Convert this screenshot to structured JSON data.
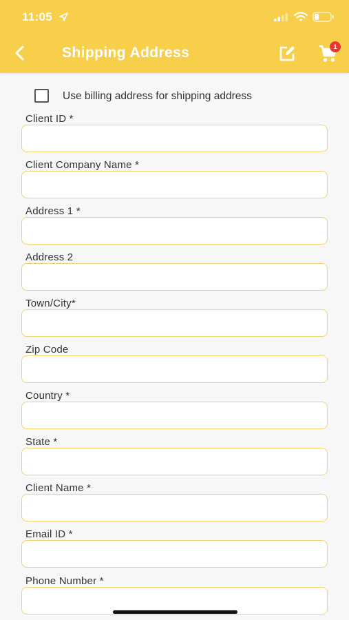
{
  "status_bar": {
    "time": "11:05",
    "icons": [
      "location-arrow-icon",
      "signal-icon",
      "wifi-icon",
      "battery-icon"
    ]
  },
  "nav": {
    "title": "Shipping Address",
    "back_icon": "chevron-left-icon",
    "edit_icon": "edit-icon",
    "cart_icon": "cart-icon",
    "cart_count": "1"
  },
  "billing_checkbox": {
    "label": "Use billing address for shipping address",
    "checked": false
  },
  "fields": [
    {
      "label": "Client ID *",
      "value": "",
      "placeholder": ""
    },
    {
      "label": "Client Company Name *",
      "value": "",
      "placeholder": ""
    },
    {
      "label": "Address 1 *",
      "value": "",
      "placeholder": ""
    },
    {
      "label": "Address 2",
      "value": "",
      "placeholder": ""
    },
    {
      "label": "Town/City*",
      "value": "",
      "placeholder": ""
    },
    {
      "label": "Zip Code",
      "value": "",
      "placeholder": ""
    },
    {
      "label": "Country *",
      "value": "",
      "placeholder": ""
    },
    {
      "label": "State *",
      "value": "",
      "placeholder": ""
    },
    {
      "label": "Client Name *",
      "value": "",
      "placeholder": ""
    },
    {
      "label": "Email ID *",
      "value": "",
      "placeholder": ""
    },
    {
      "label": "Phone Number *",
      "value": "",
      "placeholder": ""
    }
  ],
  "colors": {
    "header": "#f8cf4b",
    "input_border": "#f3d36f",
    "badge": "#e53935"
  }
}
